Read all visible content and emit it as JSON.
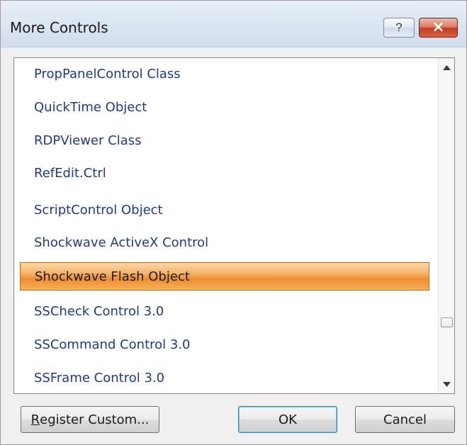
{
  "window": {
    "title": "More Controls",
    "help_glyph": "?",
    "close_glyph": "×"
  },
  "list": {
    "items": [
      "PropPanelControl Class",
      "QuickTime Object",
      "RDPViewer Class",
      "RefEdit.Ctrl",
      "ScriptControl Object",
      "Shockwave ActiveX Control",
      "Shockwave Flash Object",
      "SSCheck Control 3.0",
      "SSCommand Control 3.0",
      "SSFrame Control 3.0"
    ],
    "selected_item": "Shockwave Flash Object",
    "scroll_position_fraction": 0.83
  },
  "buttons": {
    "register_underlined": "R",
    "register_rest": "egister Custom...",
    "ok": "OK",
    "cancel": "Cancel"
  },
  "colors": {
    "item_text": "#1e3b8a",
    "selection_orange": "#ee8d30",
    "close_red": "#c43b1c"
  },
  "icons": {
    "help": "question-mark-icon",
    "close": "close-x-icon",
    "scroll_up": "arrow-up-icon",
    "scroll_down": "arrow-down-icon"
  }
}
